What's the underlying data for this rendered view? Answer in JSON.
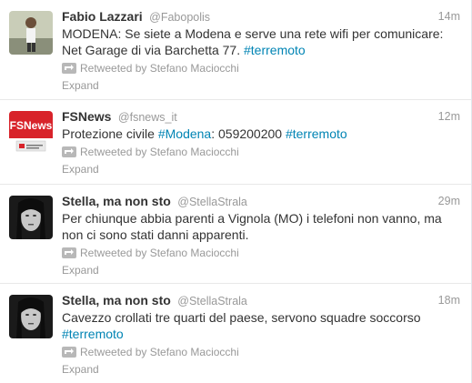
{
  "colors": {
    "link": "#0084b4",
    "muted": "#999999",
    "text": "#333333",
    "divider": "#e8e8e8"
  },
  "tweets": [
    {
      "fullname": "Fabio Lazzari",
      "username": "@Fabopolis",
      "time": "14m",
      "text_parts": [
        "MODENA: Se siete a Modena e serve una rete wifi per comunicare: Net Garage di via Barchetta 77. ",
        "#terremoto"
      ],
      "retweeted_by": "Retweeted by Stefano Maciocchi",
      "expand": "Expand",
      "avatar": "person-photo"
    },
    {
      "fullname": "FSNews",
      "username": "@fsnews_it",
      "time": "12m",
      "text_parts": [
        "Protezione civile ",
        "#Modena",
        ": 059200200 ",
        "#terremoto"
      ],
      "retweeted_by": "Retweeted by Stefano Maciocchi",
      "expand": "Expand",
      "avatar": "fsnews-logo",
      "avatar_label": "FSNews"
    },
    {
      "fullname": "Stella, ma non sto",
      "username": "@StellaStrala",
      "time": "29m",
      "text_parts": [
        "Per chiunque abbia parenti a Vignola (MO) i telefoni non vanno, ma non ci sono stati danni apparenti."
      ],
      "retweeted_by": "Retweeted by Stefano Maciocchi",
      "expand": "Expand",
      "avatar": "portrait-photo"
    },
    {
      "fullname": "Stella, ma non sto",
      "username": "@StellaStrala",
      "time": "18m",
      "text_parts": [
        "Cavezzo crollati tre quarti del paese, servono squadre soccorso ",
        "#terremoto"
      ],
      "retweeted_by": "Retweeted by Stefano Maciocchi",
      "expand": "Expand",
      "avatar": "portrait-photo"
    }
  ]
}
